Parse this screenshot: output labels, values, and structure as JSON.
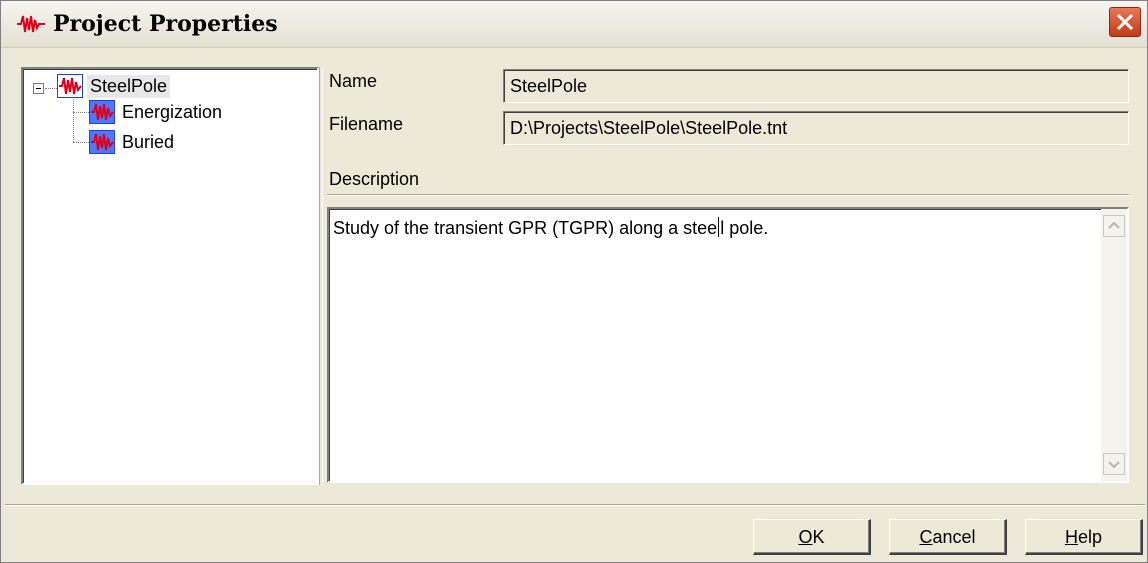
{
  "window": {
    "title": "Project Properties"
  },
  "tree": {
    "root": {
      "label": "SteelPole"
    },
    "children": [
      {
        "label": "Energization"
      },
      {
        "label": "Buried"
      }
    ]
  },
  "fields": {
    "name_label": "Name",
    "name_value": "SteelPole",
    "filename_label": "Filename",
    "filename_value": "D:\\Projects\\SteelPole\\SteelPole.tnt",
    "description_label": "Description",
    "description_before_caret": "Study of the transient GPR (TGPR) along a stee",
    "description_after_caret": "l pole."
  },
  "buttons": {
    "ok_mnemonic": "O",
    "ok_rest": "K",
    "cancel_mnemonic": "C",
    "cancel_rest": "ancel",
    "help_mnemonic": "H",
    "help_rest": "elp"
  },
  "colors": {
    "icon_red": "#e0001b",
    "icon_blue": "#1d3cff",
    "close_red": "#c23a17"
  }
}
